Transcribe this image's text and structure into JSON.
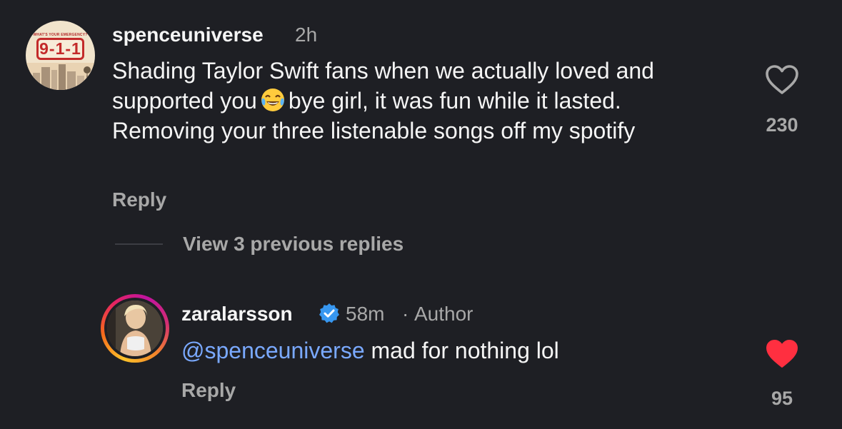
{
  "comments": [
    {
      "username": "spenceuniverse",
      "time": "2h",
      "avatar_tag": "WHAT'S YOUR EMERGENCY?",
      "avatar_logo": "9-1-1",
      "text_part1": "Shading Taylor Swift fans when we actually loved and supported you",
      "emoji": "face-with-tears-of-joy-icon",
      "text_part2": "bye girl, it was fun while it lasted. Removing your three listenable songs off my spotify",
      "reply_label": "Reply",
      "like_count": "230",
      "liked": false
    }
  ],
  "view_replies_label": "View 3 previous replies",
  "reply": {
    "username": "zaralarsson",
    "verified": true,
    "time": "58m",
    "separator": "·",
    "role": "Author",
    "mention": "@spenceuniverse",
    "text": "mad for nothing lol",
    "reply_label": "Reply",
    "like_count": "95",
    "liked": true
  },
  "colors": {
    "background": "#1e1f24",
    "mention": "#7aa9ff",
    "liked_heart": "#ff2f40",
    "verified": "#3797f0"
  }
}
